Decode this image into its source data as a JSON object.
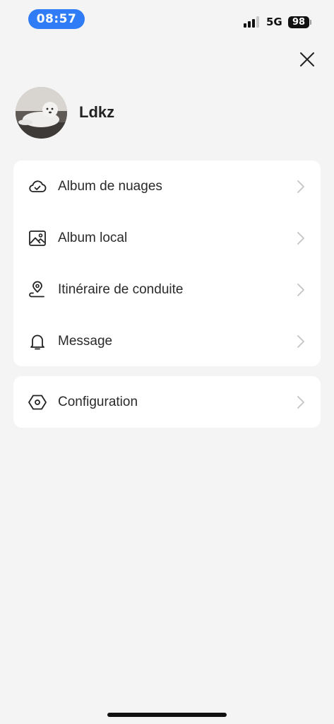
{
  "status_bar": {
    "time": "08:57",
    "network": "5G",
    "battery": "98"
  },
  "profile": {
    "username": "Ldkz"
  },
  "menu": {
    "items": [
      {
        "label": "Album de nuages",
        "icon": "cloud-check-icon"
      },
      {
        "label": "Album local",
        "icon": "image-icon"
      },
      {
        "label": "Itinéraire de conduite",
        "icon": "location-pin-icon"
      },
      {
        "label": "Message",
        "icon": "bell-icon"
      }
    ],
    "settings": {
      "label": "Configuration",
      "icon": "hexagon-settings-icon"
    }
  },
  "colors": {
    "accent": "#2f7cf6",
    "background": "#f4f4f4",
    "card": "#ffffff"
  }
}
